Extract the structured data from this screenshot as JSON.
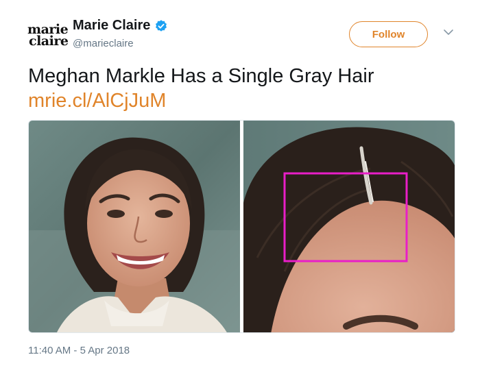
{
  "author": {
    "logo_line1": "marie",
    "logo_line2": "claire",
    "display_name": "Marie Claire",
    "handle": "@marieclaire",
    "verified": true
  },
  "actions": {
    "follow_label": "Follow"
  },
  "tweet": {
    "text": "Meghan Markle Has a Single Gray Hair",
    "link": "mrie.cl/AlCjJuM",
    "timestamp": "11:40 AM - 5 Apr 2018"
  },
  "colors": {
    "accent": "#e0842a",
    "verified": "#1da1f2",
    "highlight_box": "#e91ec8"
  }
}
